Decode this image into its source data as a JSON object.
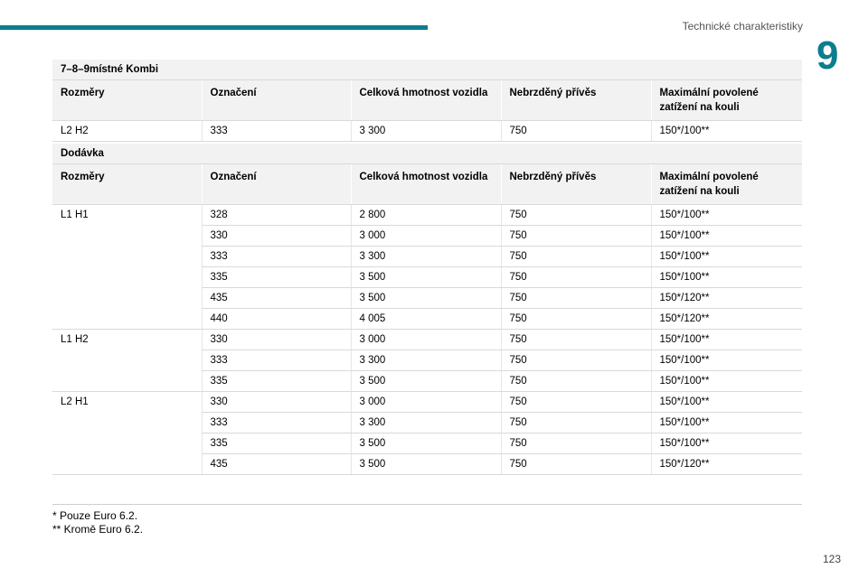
{
  "header": {
    "section_title": "Technické charakteristiky",
    "chapter": "9"
  },
  "columns": [
    "Rozměry",
    "Označení",
    "Celková hmotnost vozidla",
    "Nebrzděný přívěs",
    "Maximální povolené zatížení na kouli"
  ],
  "table_kombi": {
    "title": "7–8–9místné Kombi",
    "rows": [
      [
        "L2 H2",
        "333",
        "3 300",
        "750",
        "150*/100**"
      ]
    ]
  },
  "table_dodavka": {
    "title": "Dodávka",
    "rows": [
      [
        "L1 H1",
        "328",
        "2 800",
        "750",
        "150*/100**"
      ],
      [
        "",
        "330",
        "3 000",
        "750",
        "150*/100**"
      ],
      [
        "",
        "333",
        "3 300",
        "750",
        "150*/100**"
      ],
      [
        "",
        "335",
        "3 500",
        "750",
        "150*/100**"
      ],
      [
        "",
        "435",
        "3 500",
        "750",
        "150*/120**"
      ],
      [
        "",
        "440",
        "4 005",
        "750",
        "150*/120**"
      ],
      [
        "L1 H2",
        "330",
        "3 000",
        "750",
        "150*/100**"
      ],
      [
        "",
        "333",
        "3 300",
        "750",
        "150*/100**"
      ],
      [
        "",
        "335",
        "3 500",
        "750",
        "150*/100**"
      ],
      [
        "L2 H1",
        "330",
        "3 000",
        "750",
        "150*/100**"
      ],
      [
        "",
        "333",
        "3 300",
        "750",
        "150*/100**"
      ],
      [
        "",
        "335",
        "3 500",
        "750",
        "150*/100**"
      ],
      [
        "",
        "435",
        "3 500",
        "750",
        "150*/120**"
      ]
    ]
  },
  "footnotes": [
    "* Pouze Euro 6.2.",
    "** Kromě Euro 6.2."
  ],
  "page_number": "123",
  "colors": {
    "accent": "#0b7d8f",
    "header_fill": "#f2f2f2"
  }
}
